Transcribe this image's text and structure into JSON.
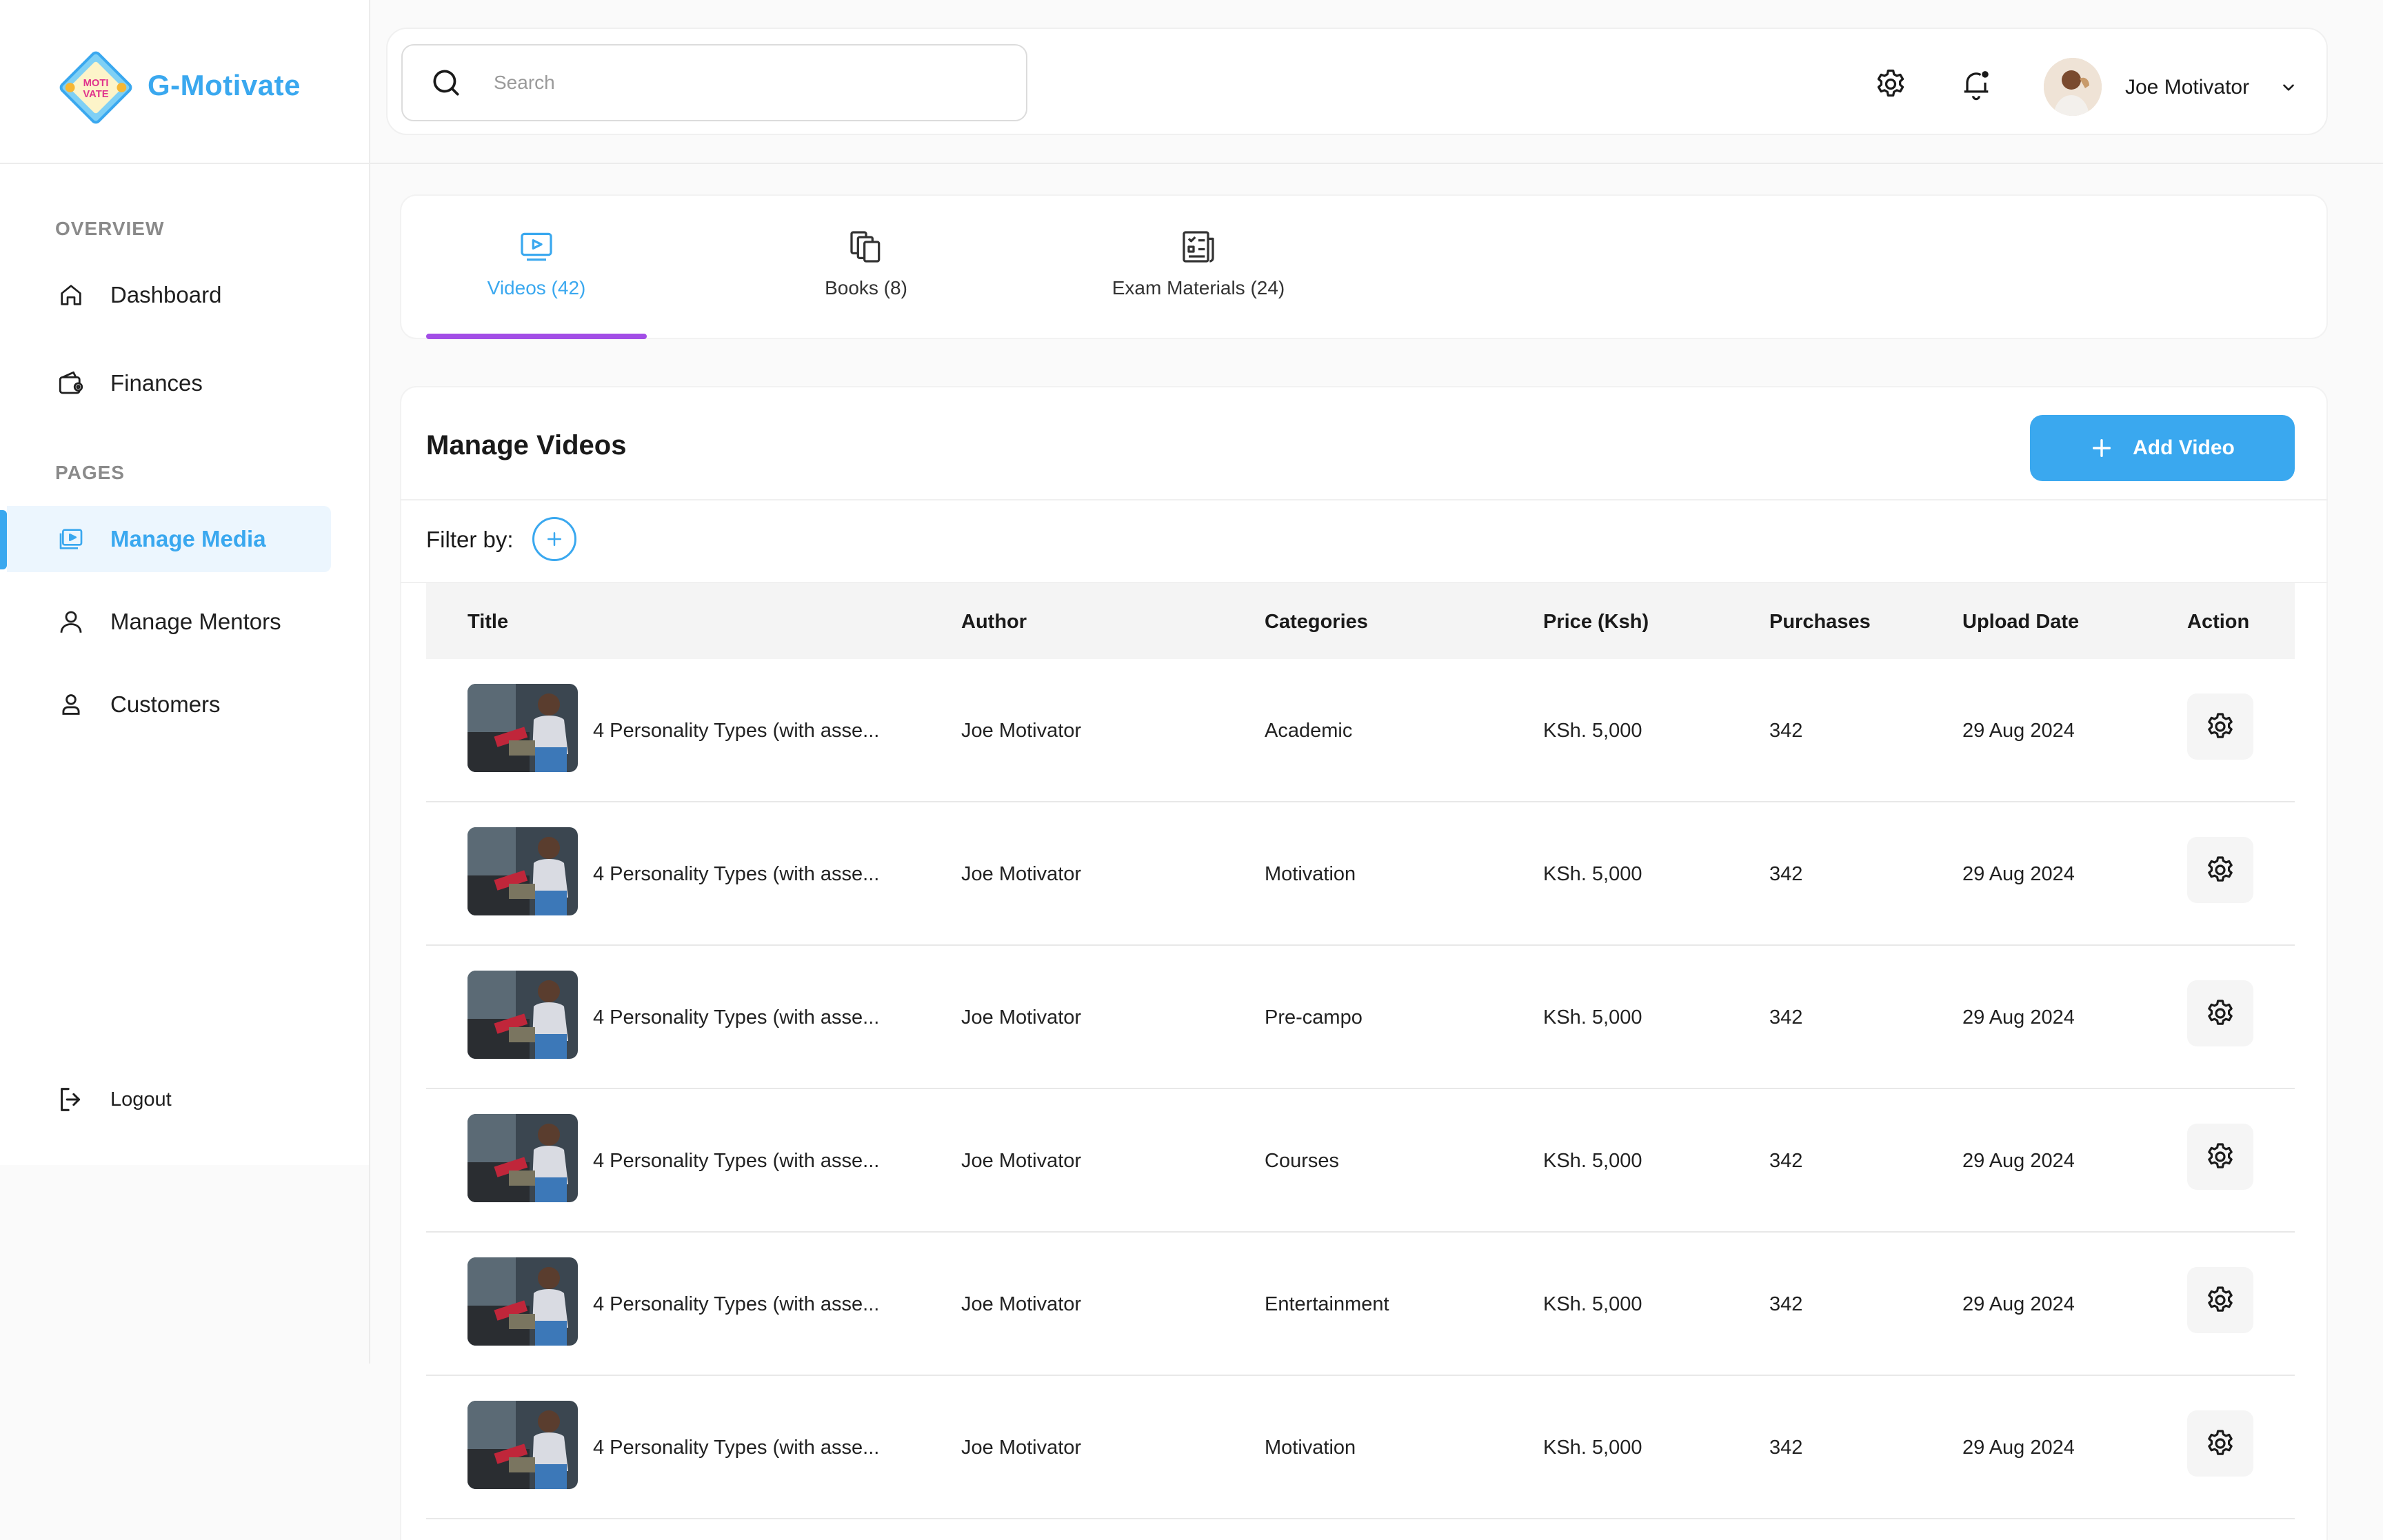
{
  "app": {
    "name": "G-Motivate",
    "logo_badge_text": "MOTIVATE"
  },
  "sidebar": {
    "overview_label": "OVERVIEW",
    "pages_label": "PAGES",
    "items": [
      {
        "label": "Dashboard",
        "icon": "home-icon"
      },
      {
        "label": "Finances",
        "icon": "wallet-icon"
      },
      {
        "label": "Manage Media",
        "icon": "video-icon",
        "active": true
      },
      {
        "label": "Manage Mentors",
        "icon": "mentor-icon"
      },
      {
        "label": "Customers",
        "icon": "user-icon"
      }
    ],
    "logout_label": "Logout"
  },
  "header": {
    "search_placeholder": "Search",
    "search_value": "",
    "user_name": "Joe Motivator"
  },
  "tabs": [
    {
      "label": "Videos (42)",
      "icon": "video-icon",
      "active": true
    },
    {
      "label": "Books (8)",
      "icon": "books-icon",
      "active": false
    },
    {
      "label": "Exam Materials (24)",
      "icon": "exam-icon",
      "active": false
    }
  ],
  "main": {
    "title": "Manage Videos",
    "add_button_label": "Add Video",
    "filter_label": "Filter by:"
  },
  "table": {
    "columns": [
      "Title",
      "Author",
      "Categories",
      "Price (Ksh)",
      "Purchases",
      "Upload Date",
      "Action"
    ],
    "rows": [
      {
        "title": "4 Personality Types (with asse...",
        "author": "Joe Motivator",
        "category": "Academic",
        "price": "KSh. 5,000",
        "purchases": "342",
        "date": "29 Aug 2024"
      },
      {
        "title": "4 Personality Types (with asse...",
        "author": "Joe Motivator",
        "category": "Motivation",
        "price": "KSh. 5,000",
        "purchases": "342",
        "date": "29 Aug 2024"
      },
      {
        "title": "4 Personality Types (with asse...",
        "author": "Joe Motivator",
        "category": "Pre-campo",
        "price": "KSh. 5,000",
        "purchases": "342",
        "date": "29 Aug 2024"
      },
      {
        "title": "4 Personality Types (with asse...",
        "author": "Joe Motivator",
        "category": "Courses",
        "price": "KSh. 5,000",
        "purchases": "342",
        "date": "29 Aug 2024"
      },
      {
        "title": "4 Personality Types (with asse...",
        "author": "Joe Motivator",
        "category": "Entertainment",
        "price": "KSh. 5,000",
        "purchases": "342",
        "date": "29 Aug 2024"
      },
      {
        "title": "4 Personality Types (with asse...",
        "author": "Joe Motivator",
        "category": "Motivation",
        "price": "KSh. 5,000",
        "purchases": "342",
        "date": "29 Aug 2024"
      }
    ]
  },
  "colors": {
    "accent": "#3aa8ef",
    "tab_underline": "#a24de6",
    "active_nav_bg": "#ecf6fe"
  }
}
